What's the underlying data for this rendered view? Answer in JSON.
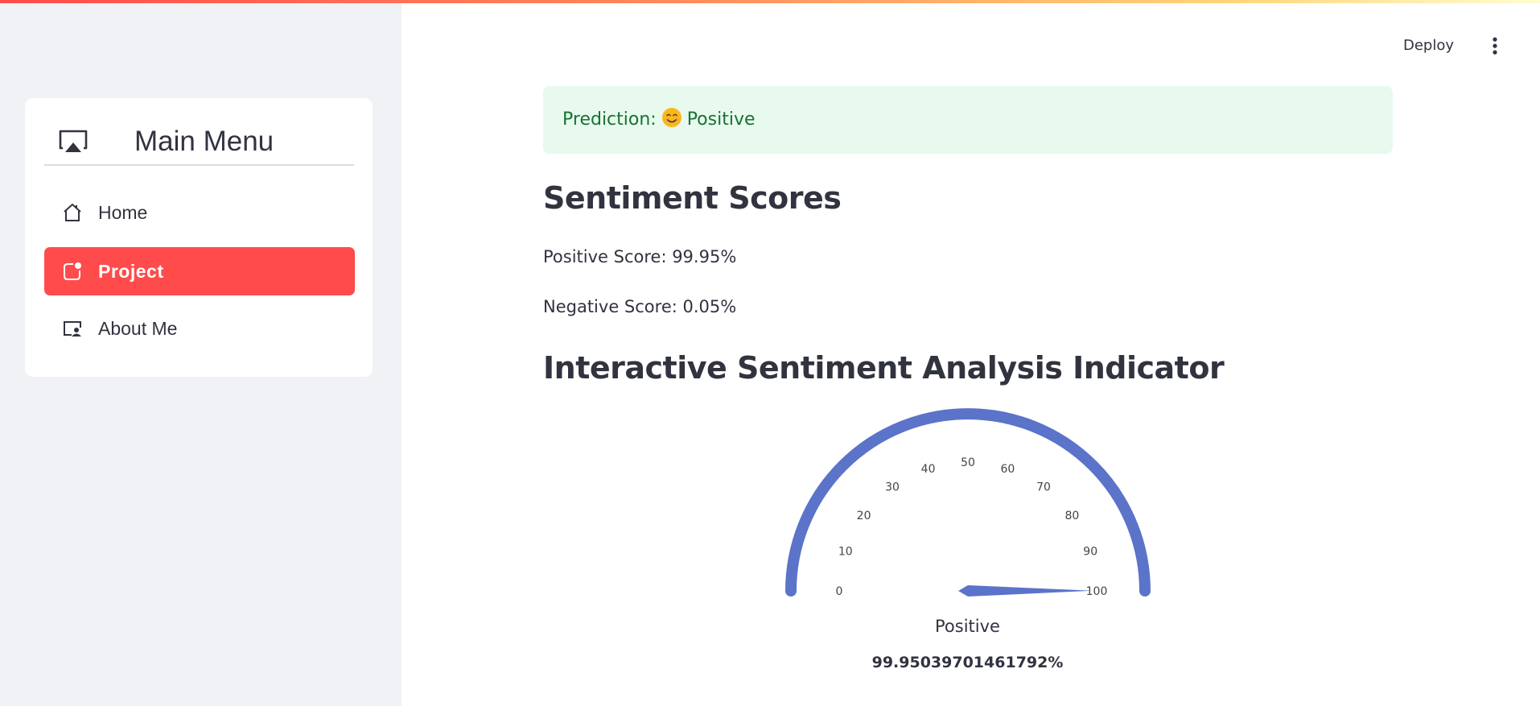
{
  "sidebar": {
    "menu_title": "Main Menu",
    "items": [
      {
        "label": "Home",
        "icon": "house-icon",
        "active": false
      },
      {
        "label": "Project",
        "icon": "app-indicator-icon",
        "active": true
      },
      {
        "label": "About Me",
        "icon": "person-video-icon",
        "active": false
      }
    ],
    "accent_color": "#ff4b4b"
  },
  "header": {
    "deploy_label": "Deploy",
    "menu_icon": "kebab-menu-icon"
  },
  "alert": {
    "prefix": "Prediction:",
    "emoji": "smiling-face-icon",
    "label": "Positive",
    "color": "#177233",
    "background": "#e8f9ee"
  },
  "scores": {
    "heading": "Sentiment Scores",
    "positive": "Positive Score: 99.95%",
    "negative": "Negative Score: 0.05%"
  },
  "indicator": {
    "heading": "Interactive Sentiment Analysis Indicator"
  },
  "chart_data": {
    "type": "gauge",
    "title": "Positive",
    "value": 99.95039701461792,
    "value_label": "99.95039701461792%",
    "range": [
      0,
      100
    ],
    "ticks": [
      "0",
      "10",
      "20",
      "30",
      "40",
      "50",
      "60",
      "70",
      "80",
      "90",
      "100"
    ],
    "arc_color": "#5b73c9",
    "needle_color": "#5b73c9"
  }
}
